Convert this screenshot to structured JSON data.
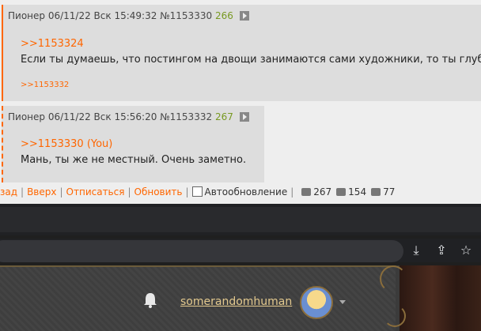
{
  "posts": [
    {
      "author": "Пионер",
      "datetime": "06/11/22 Вск 15:49:32",
      "number": "№1153330",
      "count": "266",
      "reply_to": ">>1153324",
      "text": "Если ты думаешь, что постингом на двощи занимаются сами художники, то ты глуб",
      "backref": ">>1153332"
    },
    {
      "author": "Пионер",
      "datetime": "06/11/22 Вск 15:56:20",
      "number": "№1153332",
      "count": "267",
      "reply_to": ">>1153330 (You)",
      "text": "Мань, ты же не местный. Очень заметно."
    }
  ],
  "bottom_bar": {
    "back": "зад",
    "up": "Вверх",
    "unsubscribe": "Отписаться",
    "refresh": "Обновить",
    "autoupdate": "Автообновление",
    "posts_count": "267",
    "images_count": "154",
    "users_count": "77"
  },
  "site_header": {
    "username": "somerandomhuman"
  },
  "colors": {
    "accent": "#ff6600",
    "post_bg": "#dddddd",
    "greentext": "#789922"
  }
}
